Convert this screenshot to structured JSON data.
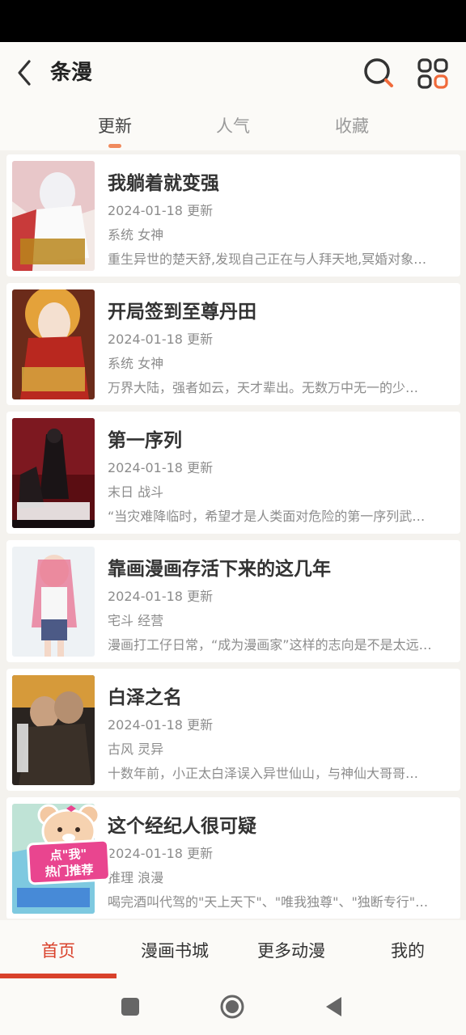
{
  "header": {
    "title": "条漫"
  },
  "tabs": [
    {
      "label": "更新",
      "active": true
    },
    {
      "label": "人气",
      "active": false
    },
    {
      "label": "收藏",
      "active": false
    }
  ],
  "comics": [
    {
      "title": "我躺着就变强",
      "date": "2024-01-18 更新",
      "tags": "系统 女神",
      "desc": "重生异世的楚天舒,发现自己正在与人拜天地,冥婚对象…"
    },
    {
      "title": "开局签到至尊丹田",
      "date": "2024-01-18 更新",
      "tags": "系统 女神",
      "desc": "万界大陆，强者如云，天才辈出。无数万中无一的少…"
    },
    {
      "title": "第一序列",
      "date": "2024-01-18 更新",
      "tags": "末日 战斗",
      "desc": "“当灾难降临时，希望才是人类面对危险的第一序列武…"
    },
    {
      "title": "靠画漫画存活下来的这几年",
      "date": "2024-01-18 更新",
      "tags": "宅斗 经营",
      "desc": "漫画打工仔日常，“成为漫画家”这样的志向是不是太远…"
    },
    {
      "title": "白泽之名",
      "date": "2024-01-18 更新",
      "tags": "古风 灵异",
      "desc": "十数年前，小正太白泽误入异世仙山，与神仙大哥哥…"
    },
    {
      "title": "这个经纪人很可疑",
      "date": "2024-01-18 更新",
      "tags": "推理 浪漫",
      "desc": "喝完酒叫代驾的\"天上天下\"、\"唯我独尊\"、\"独断专行\"…"
    }
  ],
  "promo": {
    "line1": "点\"我\"",
    "line2": "热门推荐"
  },
  "bottom_nav": [
    {
      "label": "首页",
      "active": true
    },
    {
      "label": "漫画书城",
      "active": false
    },
    {
      "label": "更多动漫",
      "active": false
    },
    {
      "label": "我的",
      "active": false
    }
  ],
  "colors": {
    "accent": "#d9412b",
    "tab_indicator": "#f08a5d",
    "promo": "#e9458f"
  }
}
